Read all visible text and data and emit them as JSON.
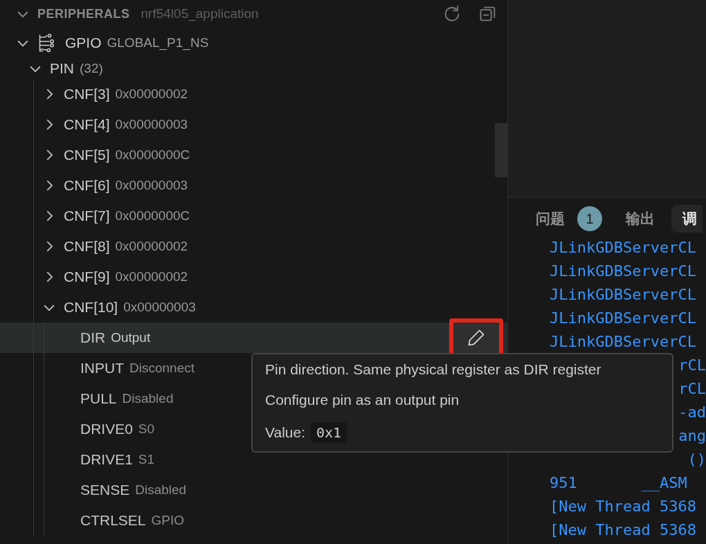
{
  "sidebar": {
    "title": "PERIPHERALS",
    "subtitle": "nrf54l05_application",
    "expanded": true,
    "tree": [
      {
        "name": "GPIO",
        "value": "GLOBAL_P1_NS",
        "kind": "peripheral",
        "expanded": true,
        "selected": false,
        "children": [
          {
            "name": "PIN",
            "value": "(32)",
            "kind": "cluster",
            "expanded": true,
            "selected": false,
            "children": [
              {
                "name": "CNF[3]",
                "value": "0x00000002",
                "kind": "register",
                "expanded": false,
                "selected": false
              },
              {
                "name": "CNF[4]",
                "value": "0x00000003",
                "kind": "register",
                "expanded": false,
                "selected": false
              },
              {
                "name": "CNF[5]",
                "value": "0x0000000C",
                "kind": "register",
                "expanded": false,
                "selected": false
              },
              {
                "name": "CNF[6]",
                "value": "0x00000003",
                "kind": "register",
                "expanded": false,
                "selected": false
              },
              {
                "name": "CNF[7]",
                "value": "0x0000000C",
                "kind": "register",
                "expanded": false,
                "selected": false
              },
              {
                "name": "CNF[8]",
                "value": "0x00000002",
                "kind": "register",
                "expanded": false,
                "selected": false
              },
              {
                "name": "CNF[9]",
                "value": "0x00000002",
                "kind": "register",
                "expanded": false,
                "selected": false
              },
              {
                "name": "CNF[10]",
                "value": "0x00000003",
                "kind": "register",
                "expanded": true,
                "selected": false,
                "children": [
                  {
                    "name": "DIR",
                    "value": "Output",
                    "kind": "field",
                    "selected": true
                  },
                  {
                    "name": "INPUT",
                    "value": "Disconnect",
                    "kind": "field",
                    "selected": false
                  },
                  {
                    "name": "PULL",
                    "value": "Disabled",
                    "kind": "field",
                    "selected": false
                  },
                  {
                    "name": "DRIVE0",
                    "value": "S0",
                    "kind": "field",
                    "selected": false
                  },
                  {
                    "name": "DRIVE1",
                    "value": "S1",
                    "kind": "field",
                    "selected": false
                  },
                  {
                    "name": "SENSE",
                    "value": "Disabled",
                    "kind": "field",
                    "selected": false
                  },
                  {
                    "name": "CTRLSEL",
                    "value": "GPIO",
                    "kind": "field",
                    "selected": false
                  }
                ]
              }
            ]
          }
        ]
      }
    ]
  },
  "tooltip": {
    "lines": [
      "Pin direction. Same physical register as DIR register",
      "Configure pin as an output pin"
    ],
    "value_label": "Value:",
    "value": "0x1"
  },
  "panel": {
    "tabs": [
      {
        "label": "问题",
        "badge": "1",
        "selected": false
      },
      {
        "label": "输出",
        "selected": false
      },
      {
        "label": "调",
        "selected": true
      }
    ],
    "lines": [
      {
        "text": "JLinkGDBServerCL",
        "kind": "full"
      },
      {
        "text": "JLinkGDBServerCL",
        "kind": "full"
      },
      {
        "text": "JLinkGDBServerCL",
        "kind": "full"
      },
      {
        "text": "JLinkGDBServerCL",
        "kind": "full"
      },
      {
        "text": "JLinkGDBServerCL",
        "kind": "full"
      },
      {
        "text": "rCL",
        "kind": "partial"
      },
      {
        "text": "rCL",
        "kind": "partial"
      },
      {
        "text": "-ad",
        "kind": "partial"
      },
      {
        "text": "ang",
        "kind": "partial"
      },
      {
        "text": "()",
        "kind": "partial"
      },
      {
        "text": "951       __ASM",
        "kind": "full"
      },
      {
        "text": "[New Thread 5368",
        "kind": "full"
      },
      {
        "text": "[New Thread 5368",
        "kind": "full"
      }
    ]
  }
}
